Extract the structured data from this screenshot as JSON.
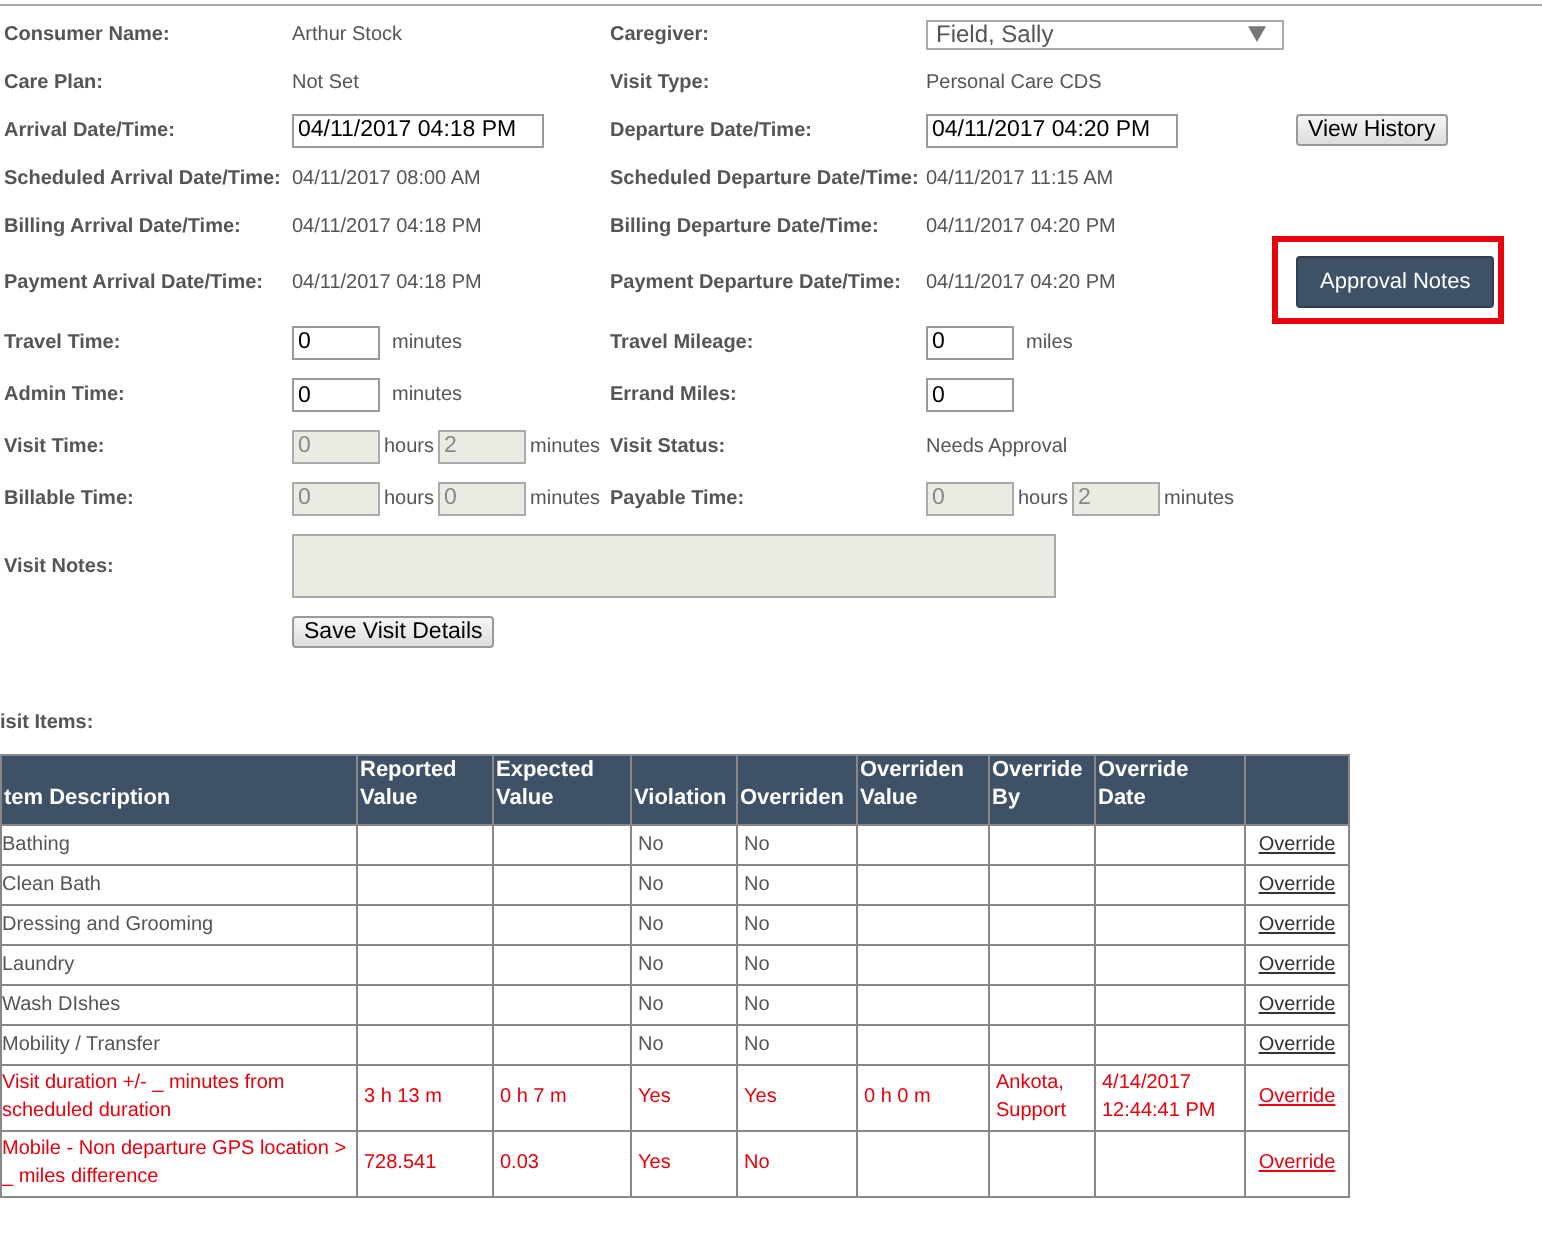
{
  "form": {
    "rows": [
      {
        "left": {
          "label": "Consumer Name:",
          "kind": "text",
          "value": "Arthur Stock"
        },
        "right": {
          "label": "Caregiver:",
          "kind": "select",
          "value": "Field, Sally"
        }
      },
      {
        "left": {
          "label": "Care Plan:",
          "kind": "text",
          "value": "Not Set"
        },
        "right": {
          "label": "Visit Type:",
          "kind": "text",
          "value": "Personal Care CDS"
        }
      },
      {
        "left": {
          "label": "Arrival Date/Time:",
          "kind": "datetime",
          "value": "04/11/2017 04:18 PM"
        },
        "right": {
          "label": "Departure Date/Time:",
          "kind": "datetime",
          "value": "04/11/2017 04:20 PM"
        },
        "action": {
          "label": "View History",
          "kind": "plain",
          "highlighted": false
        }
      },
      {
        "left": {
          "label": "Scheduled Arrival Date/Time:",
          "kind": "text",
          "value": "04/11/2017 08:00 AM"
        },
        "right": {
          "label": "Scheduled Departure Date/Time:",
          "kind": "text",
          "value": "04/11/2017 11:15 AM"
        }
      },
      {
        "left": {
          "label": "Billing Arrival Date/Time:",
          "kind": "text",
          "value": "04/11/2017 04:18 PM"
        },
        "right": {
          "label": "Billing Departure Date/Time:",
          "kind": "text",
          "value": "04/11/2017 04:20 PM"
        }
      },
      {
        "left": {
          "label": "Payment Arrival Date/Time:",
          "kind": "text",
          "value": "04/11/2017 04:18 PM"
        },
        "right": {
          "label": "Payment Departure Date/Time:",
          "kind": "text",
          "value": "04/11/2017 04:20 PM"
        },
        "action": {
          "label": "Approval Notes",
          "kind": "primary",
          "highlighted": true
        }
      },
      {
        "left": {
          "label": "Travel Time:",
          "kind": "number",
          "value": "0",
          "unit": "minutes"
        },
        "right": {
          "label": "Travel Mileage:",
          "kind": "number",
          "value": "0",
          "unit": "miles"
        }
      },
      {
        "left": {
          "label": "Admin Time:",
          "kind": "number",
          "value": "0",
          "unit": "minutes"
        },
        "right": {
          "label": "Errand Miles:",
          "kind": "number",
          "value": "0"
        }
      },
      {
        "left": {
          "label": "Visit Time:",
          "kind": "duration",
          "hours": "0",
          "hours_unit": "hours",
          "minutes": "2",
          "minutes_unit": "minutes",
          "disabled": true
        },
        "right": {
          "label": "Visit Status:",
          "kind": "text",
          "value": "Needs Approval"
        }
      },
      {
        "left": {
          "label": "Billable Time:",
          "kind": "duration",
          "hours": "0",
          "hours_unit": "hours",
          "minutes": "0",
          "minutes_unit": "minutes",
          "disabled": true
        },
        "right": {
          "label": "Payable Time:",
          "kind": "duration",
          "hours": "0",
          "hours_unit": "hours",
          "minutes": "2",
          "minutes_unit": "minutes",
          "disabled": true
        }
      },
      {
        "left": {
          "label": "Visit Notes:",
          "kind": "textarea",
          "disabled": true
        }
      }
    ],
    "save_button": "Save Visit Details"
  },
  "visit_items": {
    "title": "isit Items:",
    "columns": [
      "tem Description",
      "Reported Value",
      "Expected Value",
      "Violation",
      "Overriden",
      "Overriden Value",
      "Override By",
      "Override Date",
      ""
    ],
    "rows": [
      {
        "cells": [
          "Bathing",
          "",
          "",
          "No",
          "No",
          "",
          "",
          ""
        ],
        "link": "Override",
        "flagged": false
      },
      {
        "cells": [
          "Clean Bath",
          "",
          "",
          "No",
          "No",
          "",
          "",
          ""
        ],
        "link": "Override",
        "flagged": false
      },
      {
        "cells": [
          "Dressing and Grooming",
          "",
          "",
          "No",
          "No",
          "",
          "",
          ""
        ],
        "link": "Override",
        "flagged": false
      },
      {
        "cells": [
          "Laundry",
          "",
          "",
          "No",
          "No",
          "",
          "",
          ""
        ],
        "link": "Override",
        "flagged": false
      },
      {
        "cells": [
          "Wash DIshes",
          "",
          "",
          "No",
          "No",
          "",
          "",
          ""
        ],
        "link": "Override",
        "flagged": false
      },
      {
        "cells": [
          "Mobility / Transfer",
          "",
          "",
          "No",
          "No",
          "",
          "",
          ""
        ],
        "link": "Override",
        "flagged": false
      },
      {
        "cells": [
          "Visit duration +/- _ minutes from scheduled duration",
          "3 h 13 m",
          "0 h 7 m",
          "Yes",
          "Yes",
          "0 h 0 m",
          "Ankota, Support",
          "4/14/2017 12:44:41 PM"
        ],
        "link": "Override",
        "flagged": true
      },
      {
        "cells": [
          "Mobile - Non departure GPS location > _ miles difference",
          "728.541",
          "0.03",
          "Yes",
          "No",
          "",
          "",
          ""
        ],
        "link": "Override",
        "flagged": true
      }
    ]
  }
}
